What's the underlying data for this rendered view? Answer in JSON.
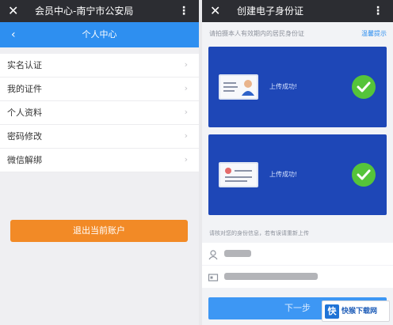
{
  "left": {
    "window_title": "会员中心-南宁市公安局",
    "close_glyph": "✕",
    "more_glyph": "⋮",
    "back_glyph": "‹",
    "sub_title": "个人中心",
    "menu": [
      {
        "label": "实名认证"
      },
      {
        "label": "我的证件"
      },
      {
        "label": "个人资料"
      },
      {
        "label": "密码修改"
      },
      {
        "label": "微信解绑"
      }
    ],
    "chevron_glyph": "›",
    "logout_label": "退出当前账户"
  },
  "right": {
    "window_title": "创建电子身份证",
    "close_glyph": "✕",
    "more_glyph": "⋮",
    "notice": "请拍摄本人有效期内的居民身份证",
    "notice_link": "温馨提示",
    "cards": [
      {
        "status": "上传成功!",
        "icon": "id-card-front-icon"
      },
      {
        "status": "上传成功!",
        "icon": "id-card-back-icon"
      }
    ],
    "hint": "请核对您的身份信息，若有误请重新上传",
    "next_label": "下一步"
  },
  "watermark": {
    "logo_char": "快",
    "text": "快猴下载网"
  },
  "colors": {
    "titlebar": "#2c2d32",
    "header_blue": "#2e8ff0",
    "card_blue": "#1e47b7",
    "success_green": "#55c43a",
    "logout_orange": "#f28a26"
  }
}
